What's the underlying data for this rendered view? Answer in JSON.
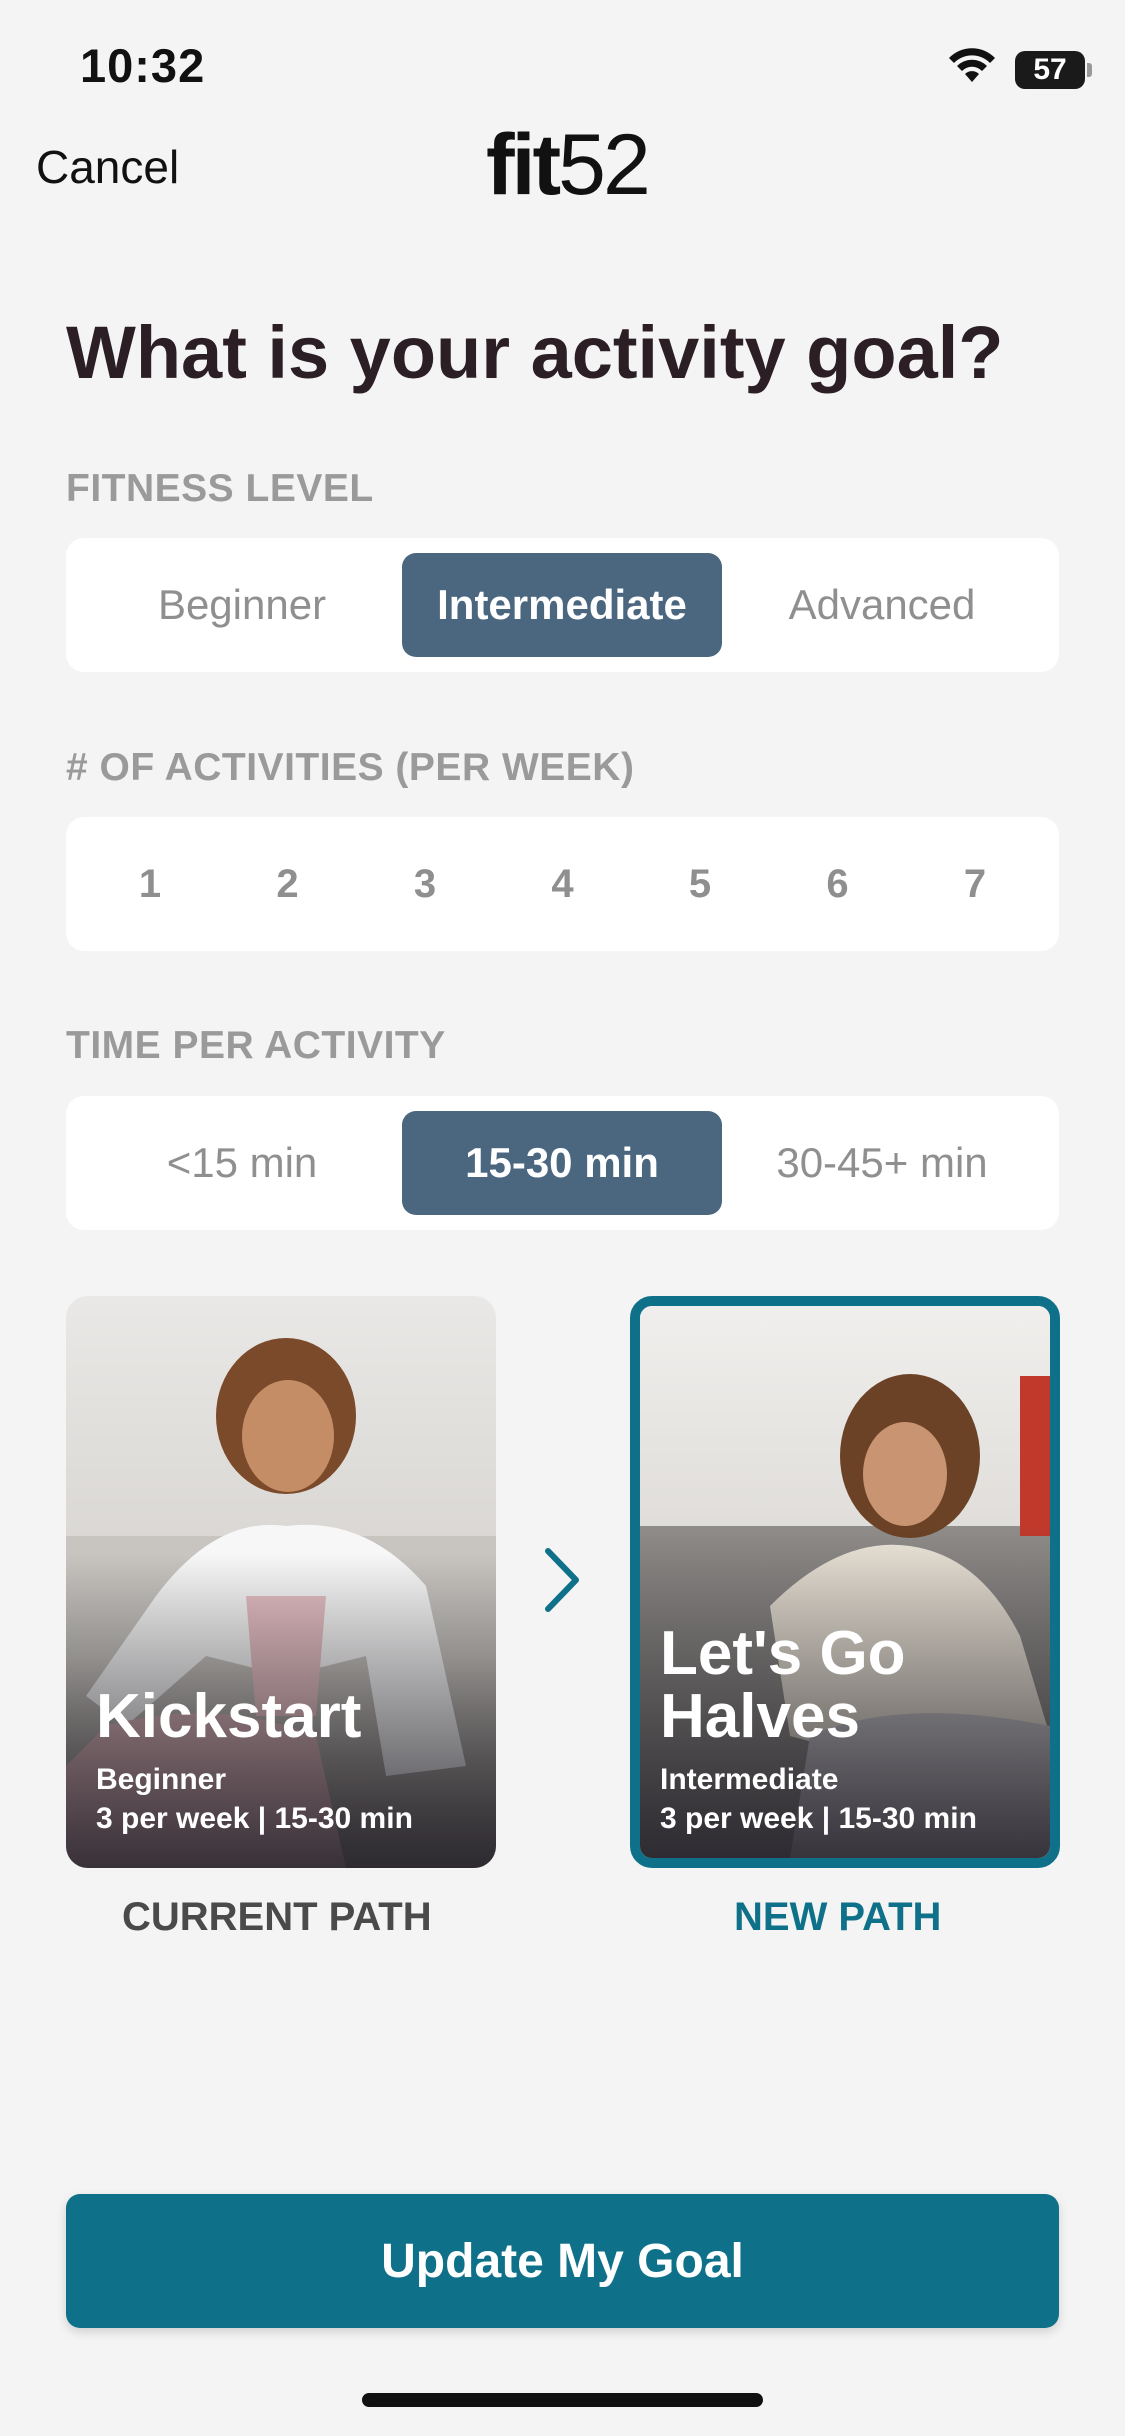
{
  "status_bar": {
    "time": "10:32",
    "battery": "57"
  },
  "nav": {
    "cancel_label": "Cancel",
    "logo_fit": "fit",
    "logo_num": "52"
  },
  "heading": "What is your activity goal?",
  "fitness_level": {
    "label": "FITNESS LEVEL",
    "options": [
      "Beginner",
      "Intermediate",
      "Advanced"
    ],
    "selected": "Intermediate"
  },
  "activities": {
    "label": "# OF ACTIVITIES (PER WEEK)",
    "options": [
      "1",
      "2",
      "3",
      "4",
      "5",
      "6",
      "7"
    ]
  },
  "time_per_activity": {
    "label": "TIME PER ACTIVITY",
    "options": [
      "<15 min",
      "15-30 min",
      "30-45+ min"
    ],
    "selected": "15-30 min"
  },
  "current_path": {
    "title": "Kickstart",
    "level": "Beginner",
    "schedule": "3 per week | 15-30 min",
    "caption": "CURRENT PATH"
  },
  "new_path": {
    "title_line1": "Let's Go",
    "title_line2": "Halves",
    "level": "Intermediate",
    "schedule": "3 per week | 15-30 min",
    "caption": "NEW PATH"
  },
  "cta_label": "Update My Goal",
  "colors": {
    "accent": "#0f7189",
    "selected_segment": "#4b6780",
    "background": "#f4f4f4"
  }
}
